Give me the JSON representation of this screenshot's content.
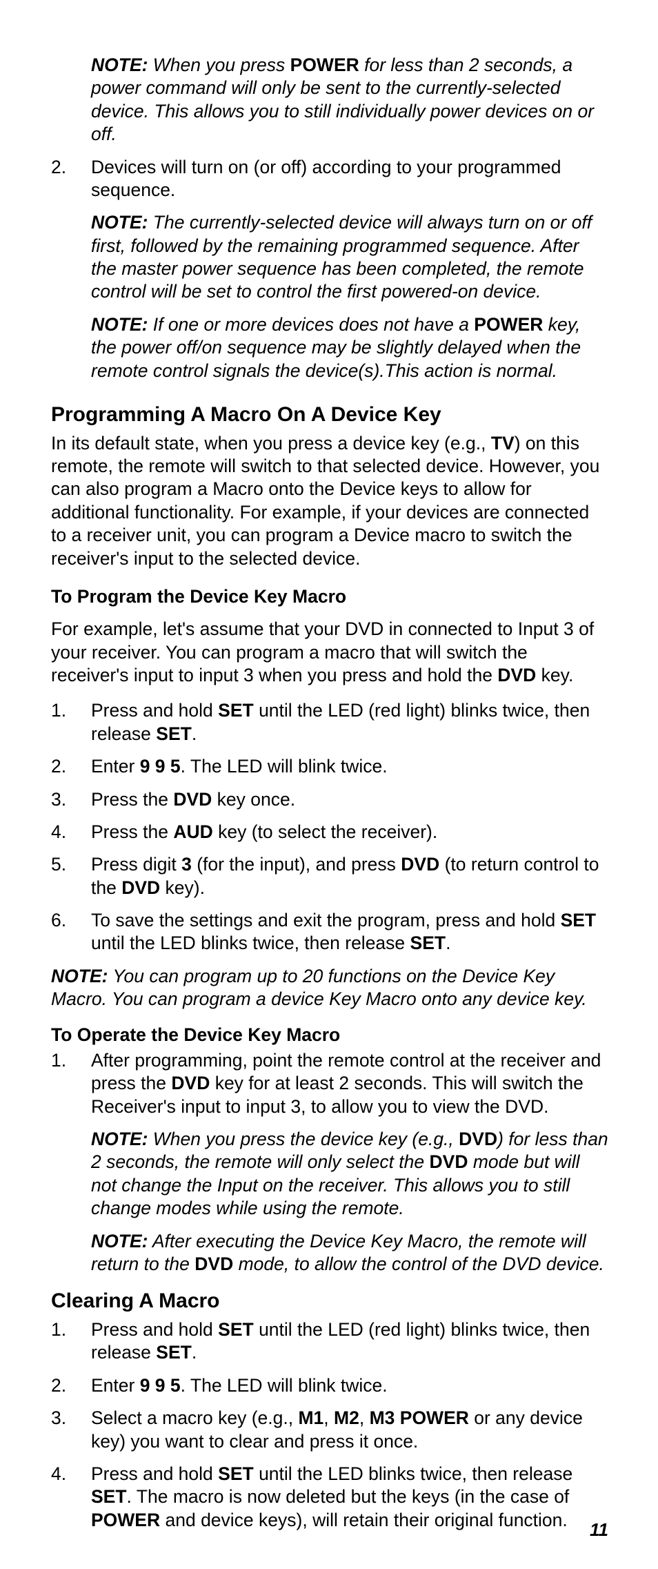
{
  "topNoteA": "<span class='lbl'>NOTE:</span> When you press <span class='nb'>POWER</span> for less than 2 seconds, a power command will only be sent to the currently-selected device. This allows you to still individually power devices on or off.",
  "list1": [
    {
      "num": "2.",
      "body": "Devices will turn on (or off) according to your programmed sequence.",
      "notes": [
        "<span class='lbl'>NOTE:</span> The currently-selected device will always turn on or off first, followed by the remaining programmed sequence. After the master power sequence has been completed, the remote control will be set to control the first powered-on device.",
        "<span class='lbl'>NOTE:</span> If one or more devices does not have a <span class='nb'>POWER</span> key, the power off/on sequence may be slightly delayed when the remote control signals the device(s).This action is normal."
      ]
    }
  ],
  "h_prog": "Programming A Macro On A Device Key",
  "p_prog": "In its default state, when you press a device key (e.g., <b>TV</b>) on this remote, the remote will switch to that selected device. However, you can also program a Macro onto the Device keys to allow for additional functionality. For example, if your devices are connected to a receiver unit, you can program a Device macro to switch the receiver's input to the selected device.",
  "h_toProgram": "To Program the Device Key Macro",
  "p_toProgram": "For example, let's assume that your DVD in connected to Input 3 of your receiver. You can program a macro that will switch the receiver's input to input 3 when you press and hold the <b>DVD</b> key.",
  "list2": [
    {
      "num": "1.",
      "body": "Press and hold <b>SET</b> until the LED (red light) blinks twice, then release <b>SET</b>."
    },
    {
      "num": "2.",
      "body": "Enter <b>9 9 5</b>. The LED will blink twice."
    },
    {
      "num": "3.",
      "body": "Press the <b>DVD</b> key once."
    },
    {
      "num": "4.",
      "body": "Press the <b>AUD</b> key (to select the receiver)."
    },
    {
      "num": "5.",
      "body": "Press digit <b>3</b> (for the input), and press <b>DVD</b> (to return control to the <b>DVD</b> key)."
    },
    {
      "num": "6.",
      "body": "To save the settings and exit the program, press and hold <b>SET</b> until the LED blinks twice, then release <b>SET</b>."
    }
  ],
  "note_after_list2": "<span class='lbl'>NOTE:</span> You can program up to 20 functions on the Device Key Macro. You can program a device Key Macro onto any device key.",
  "h_operate": "To Operate the Device Key Macro",
  "list3": [
    {
      "num": "1.",
      "body": "After programming, point the remote control at the receiver and press the <b>DVD</b> key for at least 2 seconds. This will switch the Receiver's input to input 3, to allow you to view the DVD.",
      "notes": [
        "<span class='lbl'>NOTE:</span> When you press the device key (e.g., <span class='nb'>DVD</span>) for less than 2 seconds, the remote will only select the <span class='nb'>DVD</span> mode but will not change the Input on the receiver. This allows you to still change modes while using the remote.",
        "<span class='lbl'>NOTE:</span> After executing the Device Key Macro, the remote will return to the <span class='nb'>DVD</span> mode, to allow the control of the DVD device."
      ]
    }
  ],
  "h_clear": "Clearing A Macro",
  "list4": [
    {
      "num": "1.",
      "body": "Press and hold <b>SET</b> until the LED (red light) blinks twice, then release <b>SET</b>."
    },
    {
      "num": "2.",
      "body": "Enter <b>9 9 5</b>. The LED will blink twice."
    },
    {
      "num": "3.",
      "body": "Select a macro key (e.g., <b>M1</b>, <b>M2</b>, <b>M3 POWER</b> or any device key) you want to clear and press it once."
    },
    {
      "num": "4.",
      "body": "Press and hold <b>SET</b> until the LED blinks twice, then release <b>SET</b>. The macro is now deleted but the keys (in the case of <b>POWER</b> and device keys), will retain their original function."
    }
  ],
  "pageNumber": "11"
}
